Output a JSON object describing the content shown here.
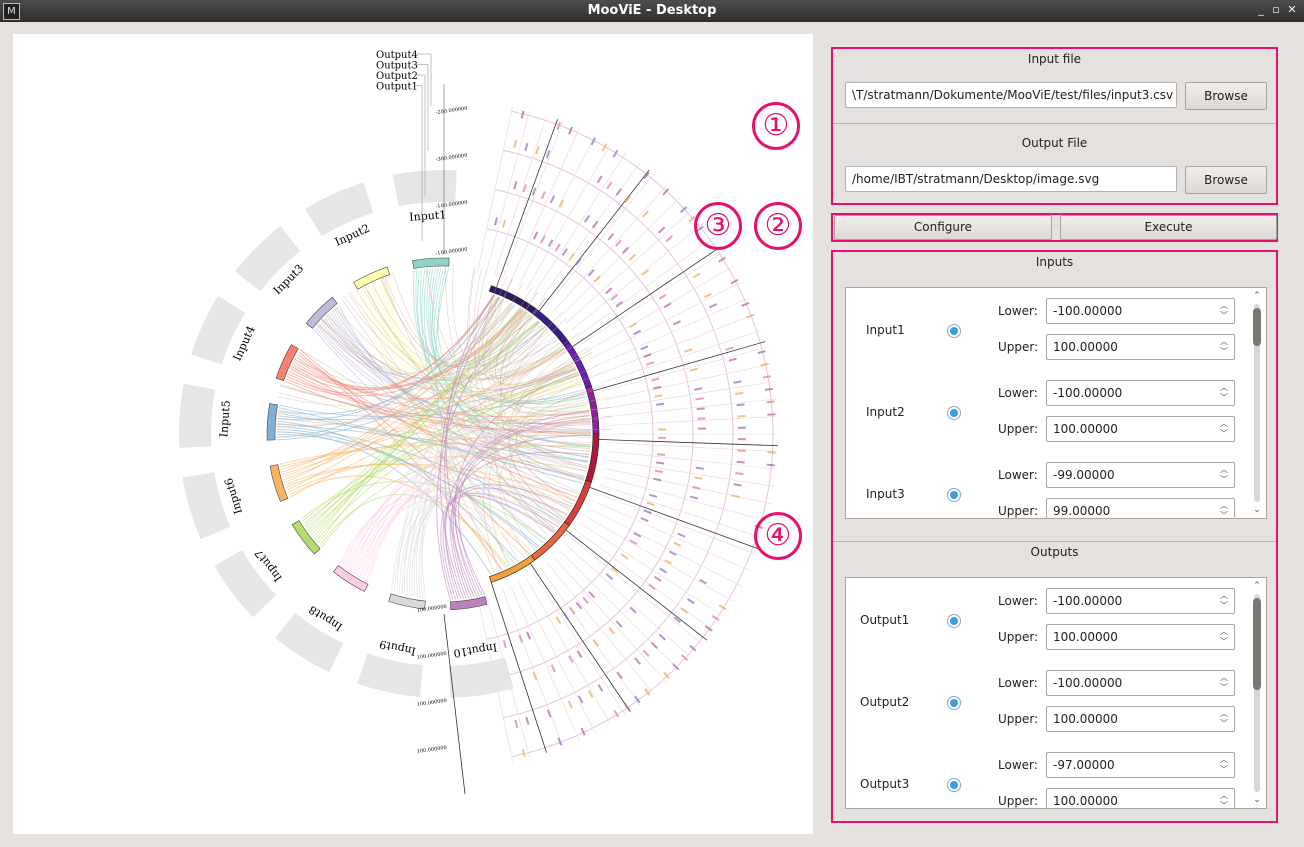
{
  "window": {
    "title": "MooViE - Desktop",
    "app_icon": "M"
  },
  "diagram": {
    "inputs": [
      {
        "label": "Input1",
        "color": "#8dd3c7"
      },
      {
        "label": "Input2",
        "color": "#ffffb3"
      },
      {
        "label": "Input3",
        "color": "#bebada"
      },
      {
        "label": "Input4",
        "color": "#fb8072"
      },
      {
        "label": "Input5",
        "color": "#80b1d3"
      },
      {
        "label": "Input6",
        "color": "#fdb462"
      },
      {
        "label": "Input7",
        "color": "#b3de69"
      },
      {
        "label": "Input8",
        "color": "#fccde5"
      },
      {
        "label": "Input9",
        "color": "#d9d9d9"
      },
      {
        "label": "Input10",
        "color": "#bc80bd"
      }
    ],
    "outputs": [
      "Output4",
      "Output3",
      "Output2",
      "Output1"
    ],
    "output_axis_top": [
      "-200.000000",
      "-300.000000",
      "-100.000000",
      "-100.000000"
    ],
    "output_axis_bottom": [
      "100.000000",
      "100.000000",
      "100.000000",
      "100.000000"
    ]
  },
  "files": {
    "input_title": "Input file",
    "input_path": "\\T/stratmann/Dokumente/MooViE/test/files/input3.csv",
    "output_title": "Output File",
    "output_path": "/home/IBT/stratmann/Desktop/image.svg",
    "browse_label": "Browse"
  },
  "actions": {
    "configure_label": "Configure",
    "execute_label": "Execute"
  },
  "inputs_section": {
    "title": "Inputs",
    "rows": [
      {
        "name": "Input1",
        "lower": "-100.00000",
        "upper": "100.00000"
      },
      {
        "name": "Input2",
        "lower": "-100.00000",
        "upper": "100.00000"
      },
      {
        "name": "Input3",
        "lower": "-99.00000",
        "upper": "99.00000"
      }
    ]
  },
  "outputs_section": {
    "title": "Outputs",
    "rows": [
      {
        "name": "Output1",
        "lower": "-100.00000",
        "upper": "100.00000"
      },
      {
        "name": "Output2",
        "lower": "-100.00000",
        "upper": "100.00000"
      },
      {
        "name": "Output3",
        "lower": "-97.00000",
        "upper": "100.00000"
      }
    ]
  },
  "labels": {
    "lower": "Lower:",
    "upper": "Upper:"
  },
  "markers": [
    "①",
    "②",
    "③",
    "④"
  ],
  "colors": {
    "accent": "#e8106c",
    "radio": "#3d9be0"
  }
}
